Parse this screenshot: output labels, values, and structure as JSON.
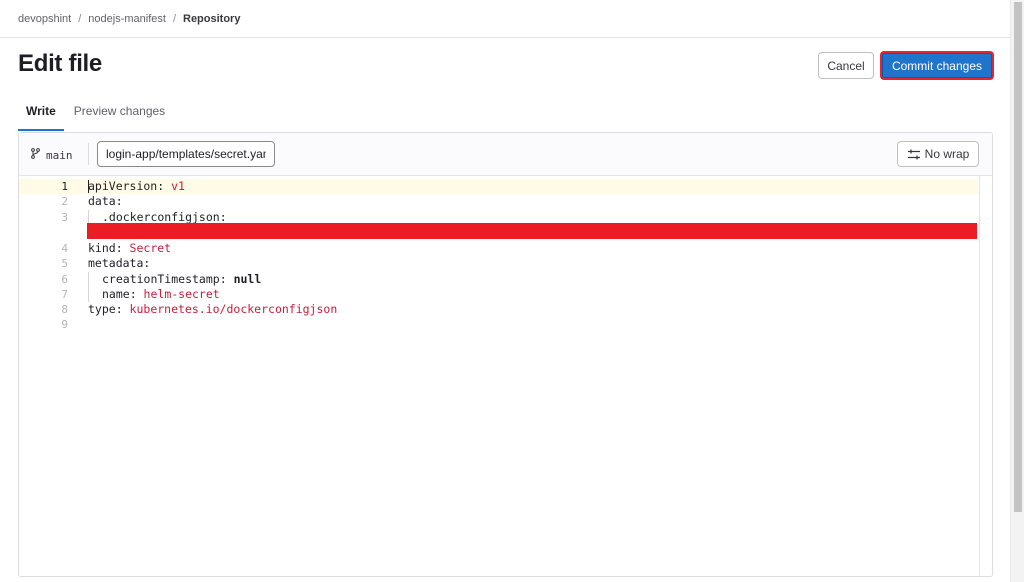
{
  "breadcrumb": {
    "items": [
      "devopshint",
      "nodejs-manifest",
      "Repository"
    ],
    "separator": "/"
  },
  "page": {
    "title": "Edit file"
  },
  "actions": {
    "cancel_label": "Cancel",
    "commit_label": "Commit changes"
  },
  "tabs": [
    {
      "label": "Write",
      "active": true
    },
    {
      "label": "Preview changes",
      "active": false
    }
  ],
  "editor": {
    "branch": "main",
    "branch_icon": "branch-icon",
    "filename": "login-app/templates/secret.yaml",
    "nowrap_label": "No wrap",
    "nowrap_icon": "wrap-icon",
    "active_line": 1,
    "lines": [
      {
        "n": "1",
        "key": "apiVersion: ",
        "value": "v1",
        "indent": 0
      },
      {
        "n": "2",
        "key": "data:",
        "value": "",
        "indent": 0
      },
      {
        "n": "3",
        "key": ".dockerconfigjson:",
        "value": "",
        "indent": 1
      },
      {
        "n": "4",
        "key": "kind: ",
        "value": "Secret",
        "indent": 0
      },
      {
        "n": "5",
        "key": "metadata:",
        "value": "",
        "indent": 0
      },
      {
        "n": "6",
        "key": "creationTimestamp: ",
        "value": "null",
        "indent": 1,
        "bold": true
      },
      {
        "n": "7",
        "key": "name: ",
        "value": "helm-secret",
        "indent": 1
      },
      {
        "n": "8",
        "key": "type: ",
        "value": "kubernetes.io/dockerconfigjson",
        "indent": 0
      },
      {
        "n": "9",
        "key": "",
        "value": "",
        "indent": 0
      }
    ]
  },
  "colors": {
    "primary": "#1f75cb",
    "highlight_border": "#e3262f",
    "redaction": "#ec1c24",
    "yaml_value": "#c91c3a"
  }
}
